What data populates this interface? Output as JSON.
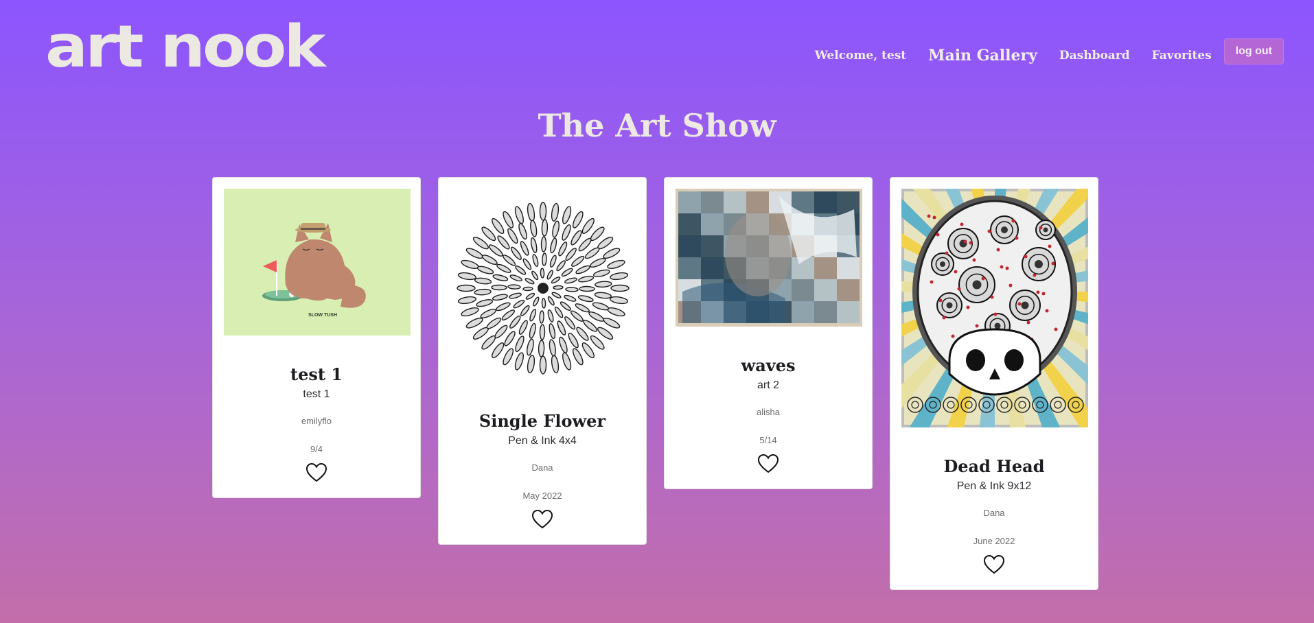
{
  "header": {
    "logo": "art nook",
    "welcome": "Welcome, test",
    "nav": [
      {
        "label": "Main Gallery"
      },
      {
        "label": "Dashboard"
      },
      {
        "label": "Favorites"
      }
    ],
    "logout_label": "log out"
  },
  "page": {
    "title": "The Art Show"
  },
  "cards": [
    {
      "title": "test 1",
      "description": "test 1",
      "artist": "emilyflo",
      "date": "9/4",
      "image_text": "SLOW TUSH"
    },
    {
      "title": "Single Flower",
      "description": "Pen & Ink 4x4",
      "artist": "Dana",
      "date": "May 2022"
    },
    {
      "title": "waves",
      "description": "art 2",
      "artist": "alisha",
      "date": "5/14"
    },
    {
      "title": "Dead Head",
      "description": "Pen & Ink 9x12",
      "artist": "Dana",
      "date": "June 2022"
    }
  ],
  "colors": {
    "gradient_top": "#8c55fe",
    "gradient_bottom": "#c36eaa",
    "text_light": "#ece8e2",
    "card_bg": "#ffffff",
    "logout_bg": "#b566d6"
  },
  "icons": {
    "favorite": "heart-outline-icon"
  }
}
